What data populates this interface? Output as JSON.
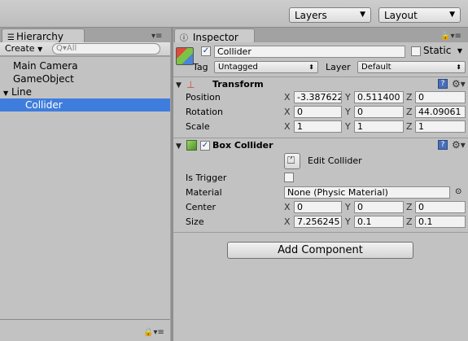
{
  "toolbar": {
    "layers_label": "Layers",
    "layout_label": "Layout",
    "dropdown_arrow": "▼"
  },
  "hierarchy": {
    "tab_label": "Hierarchy",
    "create_label": "Create",
    "search_placeholder": "Q▾All",
    "items": [
      {
        "label": "Main Camera",
        "selected": false
      },
      {
        "label": "GameObject",
        "selected": false
      },
      {
        "label": "Line",
        "expanded": true,
        "selected": false
      },
      {
        "label": "Collider",
        "selected": true
      }
    ],
    "expand_glyph": "▼"
  },
  "inspector": {
    "tab_label": "Inspector",
    "object": {
      "active_checked": true,
      "name": "Collider",
      "static_label": "Static",
      "static_checked": false,
      "tag_label": "Tag",
      "tag_value": "Untagged",
      "layer_label": "Layer",
      "layer_value": "Default"
    },
    "transform": {
      "title": "Transform",
      "position_label": "Position",
      "rotation_label": "Rotation",
      "scale_label": "Scale",
      "position": {
        "x": "-3.387622",
        "y": "0.511400",
        "z": "0"
      },
      "rotation": {
        "x": "0",
        "y": "0",
        "z": "44.09061"
      },
      "scale": {
        "x": "1",
        "y": "1",
        "z": "1"
      }
    },
    "box_collider": {
      "title": "Box Collider",
      "enabled": true,
      "edit_collider_label": "Edit Collider",
      "is_trigger_label": "Is Trigger",
      "is_trigger_checked": false,
      "material_label": "Material",
      "material_value": "None (Physic Material)",
      "center_label": "Center",
      "size_label": "Size",
      "center": {
        "x": "0",
        "y": "0",
        "z": "0"
      },
      "size": {
        "x": "7.256245",
        "y": "0.1",
        "z": "0.1"
      }
    },
    "add_component_label": "Add Component",
    "axis": {
      "x": "X",
      "y": "Y",
      "z": "Z"
    }
  },
  "colors": {
    "selection": "#3e7dde",
    "panel_bg": "#c2c2c2",
    "help_icon": "#4a6fb8"
  }
}
